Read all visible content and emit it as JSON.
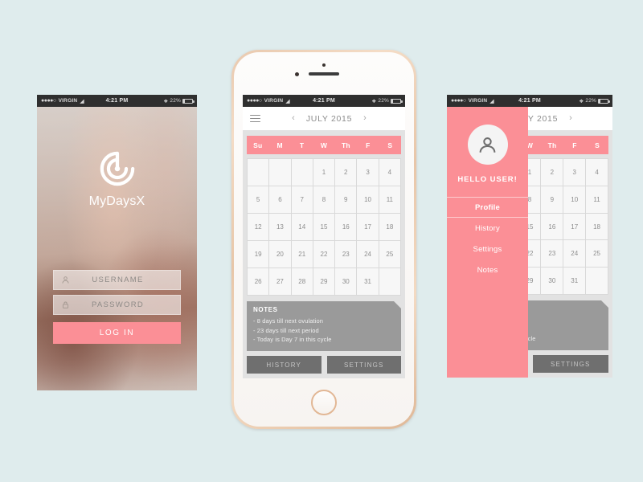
{
  "canvas": {
    "background": "#dfeced"
  },
  "theme": {
    "pink": "#fb8f96",
    "gray": "#9a9a9a",
    "dark_gray": "#6f6f6f",
    "mint": "#dfeced"
  },
  "status_bar": {
    "signal_dots": "●●●●○",
    "carrier": "VIRGIN",
    "wifi_icon": "wifi-icon",
    "time": "4:21 PM",
    "bluetooth_icon": "bluetooth-icon",
    "battery_percent": "22%"
  },
  "login_screen": {
    "name": "login-screen",
    "logo_icon": "spiral-target-logo-icon",
    "brand_name": "MyDaysX",
    "username_field": {
      "icon": "user-icon",
      "placeholder": "USERNAME",
      "value": ""
    },
    "password_field": {
      "icon": "lock-icon",
      "placeholder": "PASSWORD",
      "value": ""
    },
    "login_button": "LOG IN"
  },
  "calendar_screen": {
    "name": "calendar-screen",
    "menu_icon": "hamburger-menu-icon",
    "prev_icon": "chevron-left-icon",
    "next_icon": "chevron-right-icon",
    "title": "JULY 2015",
    "day_headers": [
      "Su",
      "M",
      "T",
      "W",
      "Th",
      "F",
      "S"
    ],
    "leading_blanks": 3,
    "days": [
      1,
      2,
      3,
      4,
      5,
      6,
      7,
      8,
      9,
      10,
      11,
      12,
      13,
      14,
      15,
      16,
      17,
      18,
      19,
      20,
      21,
      22,
      23,
      24,
      25,
      26,
      27,
      28,
      29,
      30,
      31
    ],
    "trailing_blanks": 1,
    "notes": {
      "title": "NOTES",
      "items": [
        "-  8 days till next ovulation",
        "-  23 days till next period",
        "-  Today is Day 7 in this cycle"
      ]
    },
    "buttons": {
      "history": "HISTORY",
      "settings": "SETTINGS"
    }
  },
  "menu_screen": {
    "name": "menu-screen",
    "avatar_icon": "user-avatar-icon",
    "greeting": "HELLO USER!",
    "items": [
      {
        "label": "Profile",
        "active": true
      },
      {
        "label": "History",
        "active": false
      },
      {
        "label": "Settings",
        "active": false
      },
      {
        "label": "Notes",
        "active": false
      }
    ]
  }
}
